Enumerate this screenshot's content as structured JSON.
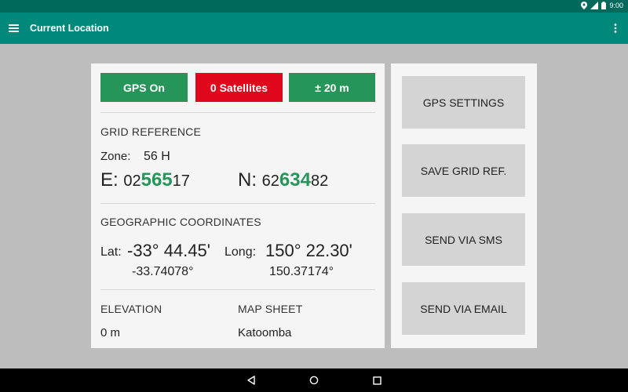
{
  "status_bar": {
    "time": "9:00"
  },
  "app_bar": {
    "title": "Current Location"
  },
  "status_buttons": {
    "gps": "GPS On",
    "satellites": "0 Satellites",
    "accuracy": "± 20 m"
  },
  "grid": {
    "title": "GRID REFERENCE",
    "zone_label": "Zone:",
    "zone_value": "56 H",
    "easting_label": "E:",
    "easting_prefix": "02",
    "easting_major": "565",
    "easting_suffix": "17",
    "northing_label": "N:",
    "northing_prefix": "62",
    "northing_major": "634",
    "northing_suffix": "82"
  },
  "geo": {
    "title": "GEOGRAPHIC COORDINATES",
    "lat_label": "Lat:",
    "lat_dms": "-33° 44.45'",
    "lat_decimal": "-33.74078°",
    "long_label": "Long:",
    "long_dms": "150° 22.30'",
    "long_decimal": "150.37174°"
  },
  "elevation": {
    "title": "ELEVATION",
    "value": "0 m"
  },
  "map_sheet": {
    "title": "MAP SHEET",
    "value": "Katoomba"
  },
  "actions": {
    "gps_settings": "GPS SETTINGS",
    "save_grid": "SAVE GRID REF.",
    "send_sms": "SEND VIA SMS",
    "send_email": "SEND VIA EMAIL"
  },
  "colors": {
    "status_bar": "#00695c",
    "app_bar": "#00897b",
    "ok": "#26955a",
    "alert": "#e0061b"
  }
}
